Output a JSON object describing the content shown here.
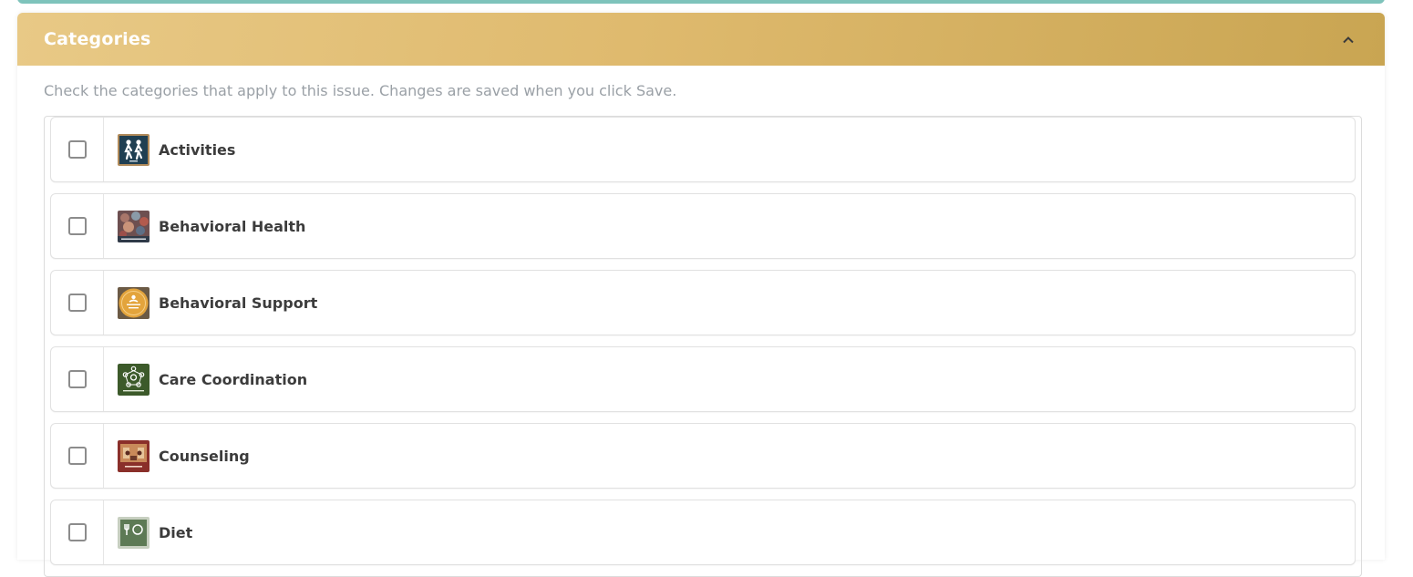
{
  "panel": {
    "title": "Categories",
    "help_text": "Check the categories that apply to this issue. Changes are saved when you click Save."
  },
  "categories": [
    {
      "label": "Activities",
      "checked": false,
      "icon": "activities-thumbnail",
      "color": "#1f3f52"
    },
    {
      "label": "Behavioral Health",
      "checked": false,
      "icon": "behavioral-health-thumbnail",
      "color": "#7c5a5a"
    },
    {
      "label": "Behavioral Support",
      "checked": false,
      "icon": "behavioral-support-thumbnail",
      "color": "#e3a43c"
    },
    {
      "label": "Care Coordination",
      "checked": false,
      "icon": "care-coordination-thumbnail",
      "color": "#3c5a2a"
    },
    {
      "label": "Counseling",
      "checked": false,
      "icon": "counseling-thumbnail",
      "color": "#8a2f2a"
    },
    {
      "label": "Diet",
      "checked": false,
      "icon": "diet-thumbnail",
      "color": "#5d7a55"
    }
  ],
  "colors": {
    "header_gradient_start": "#e8c986",
    "header_gradient_end": "#c9a552",
    "top_strip": "#7ec3bb"
  }
}
